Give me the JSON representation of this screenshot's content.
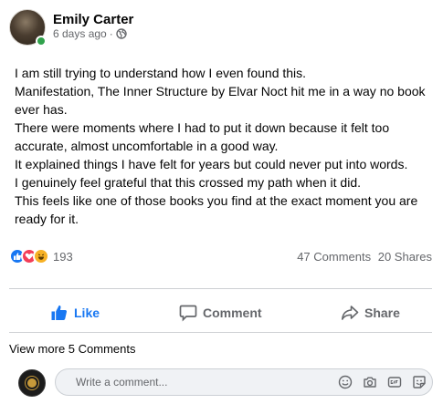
{
  "post": {
    "author": "Emily Carter",
    "time": "6 days ago",
    "separator": "·",
    "audience_icon": "globe-icon",
    "body": [
      "I am still trying to understand how I even found this.",
      "Manifestation, The Inner Structure by Elvar Noct hit me in a way no book ever has.",
      "There were moments where I had to put it down because it felt too accurate, almost uncomfortable in a good way.",
      "It explained things I have felt for years but could never put into words.",
      "I genuinely feel grateful that this crossed my path when it did.",
      "This feels like one of those books you find at the exact moment you are ready for it."
    ]
  },
  "stats": {
    "reaction_icons": [
      "like-reaction-icon",
      "love-reaction-icon",
      "haha-reaction-icon"
    ],
    "reaction_count": "193",
    "comments": "47 Comments",
    "shares": "20 Shares"
  },
  "actions": {
    "like": "Like",
    "comment": "Comment",
    "share": "Share"
  },
  "comments": {
    "view_more": "View more 5 Comments",
    "placeholder": "Write a comment...",
    "composer_icons": [
      "emoji-icon",
      "camera-icon",
      "gif-icon",
      "sticker-icon"
    ]
  },
  "colors": {
    "accent": "#1877f2",
    "online": "#31a24c",
    "muted_text": "#65676b",
    "love": "#f33e58",
    "haha": "#f7b125"
  }
}
